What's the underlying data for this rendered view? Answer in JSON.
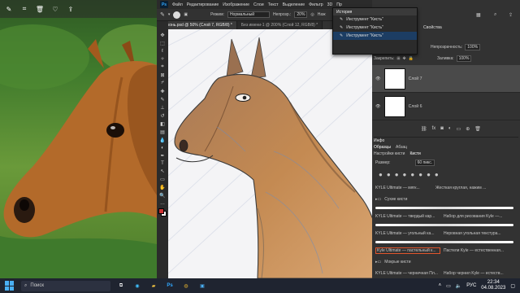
{
  "viewer": {
    "toolbar_icons": [
      "edit-icon",
      "crop-icon",
      "delete-icon",
      "favorite-icon",
      "share-icon"
    ]
  },
  "photoshop": {
    "logo": "Ps",
    "menu": [
      "Файл",
      "Редактирование",
      "Изображение",
      "Слои",
      "Текст",
      "Выделение",
      "Фильтр",
      "3D",
      "Пр"
    ],
    "options": {
      "mode_label": "Режим:",
      "mode_value": "Нормальный",
      "opacity_label": "Непрозр.:",
      "opacity_value": "20%",
      "extra_label": "Наж"
    },
    "tabs": [
      {
        "label": "конь.psd @ 50% (Слой 7, RGB/8) *",
        "active": true
      },
      {
        "label": "Без имени-1 @ 200% (Слой 12, RGB/8) *",
        "active": false
      }
    ],
    "history": {
      "title": "История",
      "items": [
        "Инструмент \"Кисть\"",
        "Инструмент \"Кисть\"",
        "Инструмент \"Кисть\""
      ]
    },
    "properties": {
      "title": "Свойства"
    },
    "layers_panel": {
      "opacity_label": "Непрозрачность:",
      "opacity_value": "100%",
      "lock_label": "Закрепить:",
      "fill_label": "Заливка:",
      "fill_value": "100%",
      "layers": [
        {
          "name": "Слой 7",
          "selected": true
        },
        {
          "name": "Слой 6",
          "selected": false
        }
      ]
    },
    "info_tab": "Инфо",
    "swatches_tabs": [
      "Образцы",
      "Абзац"
    ],
    "brush_tabs": [
      "Настройки кисти",
      "Кисти"
    ],
    "brush_panel": {
      "size_label": "Размер:",
      "size_value": "60 пикс.",
      "top_brushes": [
        "KYLE Ultimate — мягк...",
        "Жесткая круглая, нажим ..."
      ],
      "group1": "Сухие кисти",
      "group1_brushes": [
        "KYLE Ultimate — твердый кар...",
        "Набор для рисования Kyle —...",
        "KYLE Ultimate — угольный ка...",
        "Неровная угольная текстура...",
        "Kyle Ultimate — пастельный к...",
        "Пастели Kyle — естественная..."
      ],
      "group2": "Мокрые кисти",
      "group2_brushes": [
        "KYLE Ultimate — черничная Пл...",
        "Набор чернил Kyle — естеств..."
      ]
    }
  },
  "taskbar": {
    "search_placeholder": "Поиск",
    "language": "РУС",
    "time": "22:34",
    "date": "04.08.2023"
  }
}
